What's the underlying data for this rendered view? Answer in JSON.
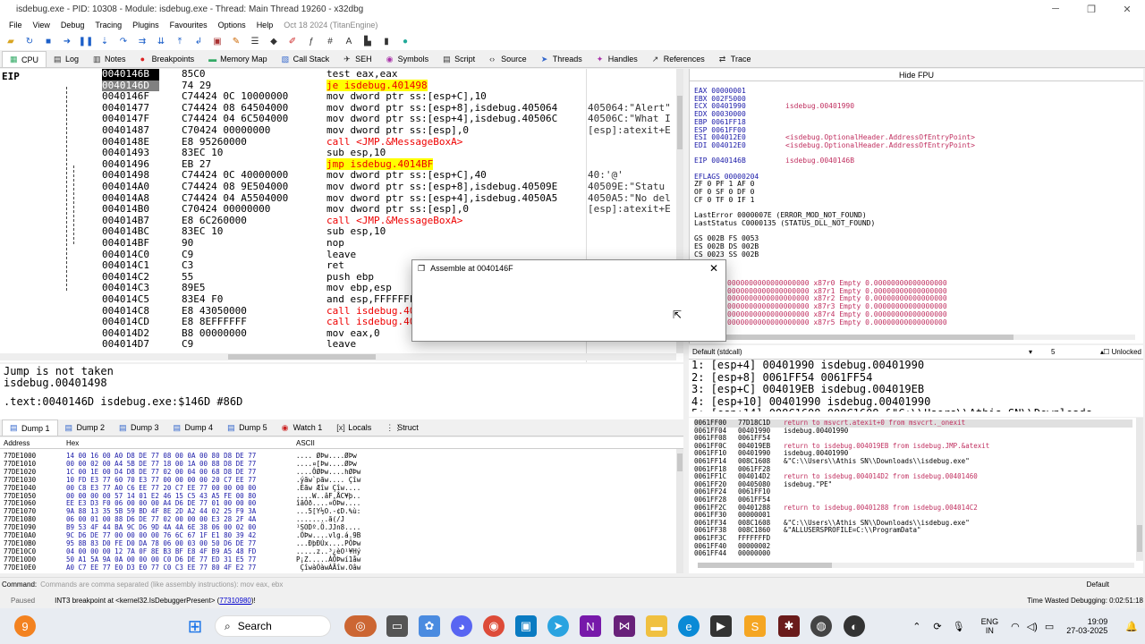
{
  "window": {
    "title": "isdebug.exe - PID: 10308 - Module: isdebug.exe - Thread: Main Thread 19260 - x32dbg"
  },
  "menu": {
    "items": [
      "File",
      "View",
      "Debug",
      "Tracing",
      "Plugins",
      "Favourites",
      "Options",
      "Help"
    ],
    "date": "Oct 18 2024 (TitanEngine)"
  },
  "tabs_main": [
    {
      "label": "CPU",
      "icon": "cpu-icon"
    },
    {
      "label": "Log",
      "icon": "log-icon"
    },
    {
      "label": "Notes",
      "icon": "notes-icon"
    },
    {
      "label": "Breakpoints",
      "icon": "breakpoint-icon"
    },
    {
      "label": "Memory Map",
      "icon": "memory-icon"
    },
    {
      "label": "Call Stack",
      "icon": "callstack-icon"
    },
    {
      "label": "SEH",
      "icon": "seh-icon"
    },
    {
      "label": "Symbols",
      "icon": "symbols-icon"
    },
    {
      "label": "Script",
      "icon": "script-icon"
    },
    {
      "label": "Source",
      "icon": "source-icon"
    },
    {
      "label": "Threads",
      "icon": "threads-icon"
    },
    {
      "label": "Handles",
      "icon": "handles-icon"
    },
    {
      "label": "References",
      "icon": "references-icon"
    },
    {
      "label": "Trace",
      "icon": "trace-icon"
    }
  ],
  "cpu": {
    "eip_label": "EIP",
    "rows": [
      {
        "addr": "0040146B",
        "bytes": "85C0",
        "instr": "test eax,eax",
        "cmt": "",
        "kind": "eip"
      },
      {
        "addr": "0040146D",
        "bytes": "74 29",
        "instr": "je isdebug.401498",
        "cmt": "",
        "kind": "sel"
      },
      {
        "addr": "0040146F",
        "bytes": "C74424 0C 10000000",
        "instr": "mov dword ptr ss:[esp+C],10",
        "cmt": ""
      },
      {
        "addr": "00401477",
        "bytes": "C74424 08 64504000",
        "instr": "mov dword ptr ss:[esp+8],isdebug.405064",
        "cmt": "405064:\"Alert\""
      },
      {
        "addr": "0040147F",
        "bytes": "C74424 04 6C504000",
        "instr": "mov dword ptr ss:[esp+4],isdebug.40506C",
        "cmt": "40506C:\"What I"
      },
      {
        "addr": "00401487",
        "bytes": "C70424 00000000",
        "instr": "mov dword ptr ss:[esp],0",
        "cmt": "[esp]:atexit+E"
      },
      {
        "addr": "0040148E",
        "bytes": "E8 95260000",
        "instr": "call <JMP.&MessageBoxA>",
        "cmt": "",
        "call": true
      },
      {
        "addr": "00401493",
        "bytes": "83EC 10",
        "instr": "sub esp,10",
        "cmt": ""
      },
      {
        "addr": "00401496",
        "bytes": "EB 27",
        "instr": "jmp isdebug.4014BF",
        "cmt": "",
        "jmp": true
      },
      {
        "addr": "00401498",
        "bytes": "C74424 0C 40000000",
        "instr": "mov dword ptr ss:[esp+C],40",
        "cmt": "40:'@'"
      },
      {
        "addr": "004014A0",
        "bytes": "C74424 08 9E504000",
        "instr": "mov dword ptr ss:[esp+8],isdebug.40509E",
        "cmt": "40509E:\"Statu"
      },
      {
        "addr": "004014A8",
        "bytes": "C74424 04 A5504000",
        "instr": "mov dword ptr ss:[esp+4],isdebug.4050A5",
        "cmt": "4050A5:\"No del"
      },
      {
        "addr": "004014B0",
        "bytes": "C70424 00000000",
        "instr": "mov dword ptr ss:[esp],0",
        "cmt": "[esp]:atexit+E"
      },
      {
        "addr": "004014B7",
        "bytes": "E8 6C260000",
        "instr": "call <JMP.&MessageBoxA>",
        "cmt": "",
        "call": true
      },
      {
        "addr": "004014BC",
        "bytes": "83EC 10",
        "instr": "sub esp,10",
        "cmt": ""
      },
      {
        "addr": "004014BF",
        "bytes": "90",
        "instr": "nop",
        "cmt": ""
      },
      {
        "addr": "004014C0",
        "bytes": "C9",
        "instr": "leave",
        "cmt": ""
      },
      {
        "addr": "004014C1",
        "bytes": "C3",
        "instr": "ret",
        "cmt": ""
      },
      {
        "addr": "004014C2",
        "bytes": "55",
        "instr": "push ebp",
        "cmt": ""
      },
      {
        "addr": "004014C3",
        "bytes": "89E5",
        "instr": "mov ebp,esp",
        "cmt": ""
      },
      {
        "addr": "004014C5",
        "bytes": "83E4 F0",
        "instr": "and esp,FFFFFFF0",
        "cmt": ""
      },
      {
        "addr": "004014C8",
        "bytes": "E8 43050000",
        "instr": "call isdebug.4019F0",
        "cmt": "",
        "call": true
      },
      {
        "addr": "004014CD",
        "bytes": "E8 8EFFFFFF",
        "instr": "call isdebug.401460",
        "cmt": "",
        "call": true
      },
      {
        "addr": "004014D2",
        "bytes": "B8 00000000",
        "instr": "mov eax,0",
        "cmt": ""
      },
      {
        "addr": "004014D7",
        "bytes": "C9",
        "instr": "leave",
        "cmt": ""
      }
    ]
  },
  "registers": {
    "hide_fpu": "Hide FPU",
    "lines": [
      {
        "t": "EAX  00000001",
        "c": ""
      },
      {
        "t": "EBX  002F5000",
        "c": ""
      },
      {
        "t": "ECX  00401990",
        "c": "isdebug.00401990"
      },
      {
        "t": "EDX  00030000",
        "c": ""
      },
      {
        "t": "EBP  0061FF18",
        "c": ""
      },
      {
        "t": "ESP  0061FF00",
        "c": ""
      },
      {
        "t": "ESI  004012E0",
        "c": "<isdebug.OptionalHeader.AddressOfEntryPoint>"
      },
      {
        "t": "EDI  004012E0",
        "c": "<isdebug.OptionalHeader.AddressOfEntryPoint>"
      },
      {
        "t": "",
        "c": ""
      },
      {
        "t": "EIP  0040146B",
        "c": "isdebug.0040146B"
      },
      {
        "t": "",
        "c": ""
      },
      {
        "t": "EFLAGS  00000204",
        "c": ""
      },
      {
        "t": "ZF 0  PF 1  AF 0",
        "c": ""
      },
      {
        "t": "OF 0  SF 0  DF 0",
        "c": ""
      },
      {
        "t": "CF 0  TF 0  IF 1",
        "c": ""
      },
      {
        "t": "",
        "c": ""
      },
      {
        "t": "LastError  0000007E (ERROR_MOD_NOT_FOUND)",
        "c": ""
      },
      {
        "t": "LastStatus C0000135 (STATUS_DLL_NOT_FOUND)",
        "c": ""
      },
      {
        "t": "",
        "c": ""
      },
      {
        "t": "GS 002B  FS 0053",
        "c": ""
      },
      {
        "t": "ES 002B  DS 002B",
        "c": ""
      },
      {
        "t": "CS 0023  SS 002B",
        "c": ""
      }
    ],
    "fpu": [
      "0000000000000000000 x87r0 Empty 0.00000000000000000",
      "0000000000000000000 x87r1 Empty 0.00000000000000000",
      "0000000000000000000 x87r2 Empty 0.00000000000000000",
      "0000000000000000000 x87r3 Empty 0.00000000000000000",
      "0000000000000000000 x87r4 Empty 0.00000000000000000",
      "0000000000000000000 x87r5 Empty 0.00000000000000000"
    ]
  },
  "callconv": {
    "label": "Default (stdcall)",
    "count": "5",
    "unlocked": "Unlocked",
    "rows": [
      "1: [esp+4] 00401990 isdebug.00401990",
      "2: [esp+8] 0061FF54 0061FF54",
      "3: [esp+C] 004019EB isdebug.004019EB",
      "4: [esp+10] 00401990 isdebug.00401990",
      "5: [esp+14] 008C1608 008C1608 &\"C:\\\\Users\\\\Athis SN\\\\Downloads"
    ]
  },
  "info": {
    "line1": "Jump is not taken",
    "line2": "isdebug.00401498",
    "line3": ".text:0040146D isdebug.exe:$146D #86D"
  },
  "tabs_dump": [
    {
      "label": "Dump 1"
    },
    {
      "label": "Dump 2"
    },
    {
      "label": "Dump 3"
    },
    {
      "label": "Dump 4"
    },
    {
      "label": "Dump 5"
    },
    {
      "label": "Watch 1"
    },
    {
      "label": "Locals"
    },
    {
      "label": "Struct"
    }
  ],
  "dump": {
    "hdr_address": "Address",
    "hdr_hex": "Hex",
    "hdr_ascii": "ASCII",
    "rows": [
      {
        "a": "77DE1000",
        "h": "14 00 16 00 A0 D8 DE 77 08 00 0A 00 80 D8 DE 77",
        "s": ".... ØÞw....ØÞw"
      },
      {
        "a": "77DE1010",
        "h": "00 00 02 00 A4 5B DE 77 18 00 1A 00 88 D8 DE 77",
        "s": "....¤[Þw....ØÞw"
      },
      {
        "a": "77DE1020",
        "h": "1C 00 1E 00 D4 D8 DE 77 02 00 04 00 68 D8 DE 77",
        "s": "....ÔØÞw....hØÞw"
      },
      {
        "a": "77DE1030",
        "h": "10 FD E3 77 60 70 E3 77 00 00 00 00 20 C7 EE 77",
        "s": ".ýãw`pãw.... Çîw"
      },
      {
        "a": "77DE1040",
        "h": "00 C8 E3 77 A0 C6 EE 77 20 C7 EE 77 00 00 00 00",
        "s": ".Èãw Æîw Çîw...."
      },
      {
        "a": "77DE1050",
        "h": "00 00 00 00 57 14 01 E2 46 15 C5 43 A5 FE 00 80",
        "s": "....W..âF.ÅC¥þ.."
      },
      {
        "a": "77DE1060",
        "h": "EE E3 D3 F0 06 00 00 00 A4 D6 DE 77 01 00 00 00",
        "s": "îãÓð....¤ÖÞw...."
      },
      {
        "a": "77DE1070",
        "h": "9A 88 13 35 5B 59 BD 4F 8E 2D A2 44 02 25 F9 3A",
        "s": "...5[Y½O.-¢D.%ù:"
      },
      {
        "a": "77DE1080",
        "h": "06 00 01 00 88 D6 DE 77 02 00 00 00 E3 28 2F 4A",
        "s": "........ã(/J"
      },
      {
        "a": "77DE1090",
        "h": "B9 53 4F 44 BA 9C D6 9D 4A 4A 6E 38 06 00 02 00",
        "s": "¹SODº.Ö.JJn8...."
      },
      {
        "a": "77DE10A0",
        "h": "9C D6 DE 77 00 00 00 00 76 6C 67 1F E1 80 39 42",
        "s": ".ÖÞw....vlg.á.9B"
      },
      {
        "a": "77DE10B0",
        "h": "95 8B 83 D0 FE D0 DA 78 06 00 03 00 50 D6 DE 77",
        "s": "...ÐþÐÚx....PÖÞw"
      },
      {
        "a": "77DE10C0",
        "h": "04 00 00 00 12 7A 0F 8E B3 BF E8 4F B9 A5 48 FD",
        "s": ".....z..³¿èO¹¥Hý"
      },
      {
        "a": "77DE10D0",
        "h": "50 A1 5A 9A 0A 00 00 00 C0 D6 DE 77 ED 31 E5 77",
        "s": "P¡Z.....ÀÖÞwí1åw"
      },
      {
        "a": "77DE10E0",
        "h": "A0 C7 EE 77 E0 D3 E0 77 C0 C3 EE 77 80 4F E2 77",
        "s": " ÇîwàÓàwÀÃîw.Oâw"
      }
    ]
  },
  "stack": {
    "rows": [
      {
        "a": "0061FF00",
        "v": "77D18C1D",
        "c": "return to msvcrt.atexit+0 from msvcrt._onexit",
        "red": true
      },
      {
        "a": "0061FF04",
        "v": "00401990",
        "c": "isdebug.00401990"
      },
      {
        "a": "0061FF08",
        "v": "0061FF54",
        "c": ""
      },
      {
        "a": "0061FF0C",
        "v": "004019EB",
        "c": "return to isdebug.004019EB from isdebug.JMP.&atexit",
        "red": true
      },
      {
        "a": "0061FF10",
        "v": "00401990",
        "c": "isdebug.00401990"
      },
      {
        "a": "0061FF14",
        "v": "008C1608",
        "c": "&\"C:\\\\Users\\\\Athis SN\\\\Downloads\\\\isdebug.exe\""
      },
      {
        "a": "0061FF18",
        "v": "0061FF28",
        "c": ""
      },
      {
        "a": "0061FF1C",
        "v": "004014D2",
        "c": "return to isdebug.004014D2 from isdebug.00401460",
        "red": true
      },
      {
        "a": "0061FF20",
        "v": "00405080",
        "c": "isdebug.\"PE\""
      },
      {
        "a": "0061FF24",
        "v": "0061FF10",
        "c": ""
      },
      {
        "a": "0061FF28",
        "v": "0061FF54",
        "c": ""
      },
      {
        "a": "0061FF2C",
        "v": "00401288",
        "c": "return to isdebug.00401288 from isdebug.004014C2",
        "red": true
      },
      {
        "a": "0061FF30",
        "v": "00000001",
        "c": ""
      },
      {
        "a": "0061FF34",
        "v": "008C1608",
        "c": "&\"C:\\\\Users\\\\Athis SN\\\\Downloads\\\\isdebug.exe\""
      },
      {
        "a": "0061FF38",
        "v": "008C1860",
        "c": "&\"ALLUSERSPROFILE=C:\\\\ProgramData\""
      },
      {
        "a": "0061FF3C",
        "v": "FFFFFFFD",
        "c": ""
      },
      {
        "a": "0061FF40",
        "v": "00000002",
        "c": ""
      },
      {
        "a": "0061FF44",
        "v": "00000000",
        "c": ""
      }
    ]
  },
  "command": {
    "label": "Command:",
    "placeholder": "Commands are comma separated (like assembly instructions): mov eax, ebx",
    "default": "Default"
  },
  "status": {
    "paused": "Paused",
    "msg": "INT3 breakpoint at <kernel32.IsDebuggerPresent> (",
    "link": "77310980",
    "msg_end": ")!",
    "time": "Time Wasted Debugging: 0:02:51:18"
  },
  "dialog": {
    "title": "Assemble at 0040146F"
  },
  "taskbar": {
    "search": "Search",
    "lang1": "ENG",
    "lang2": "IN",
    "time": "19:09",
    "date": "27-03-2025",
    "badge": "9"
  }
}
